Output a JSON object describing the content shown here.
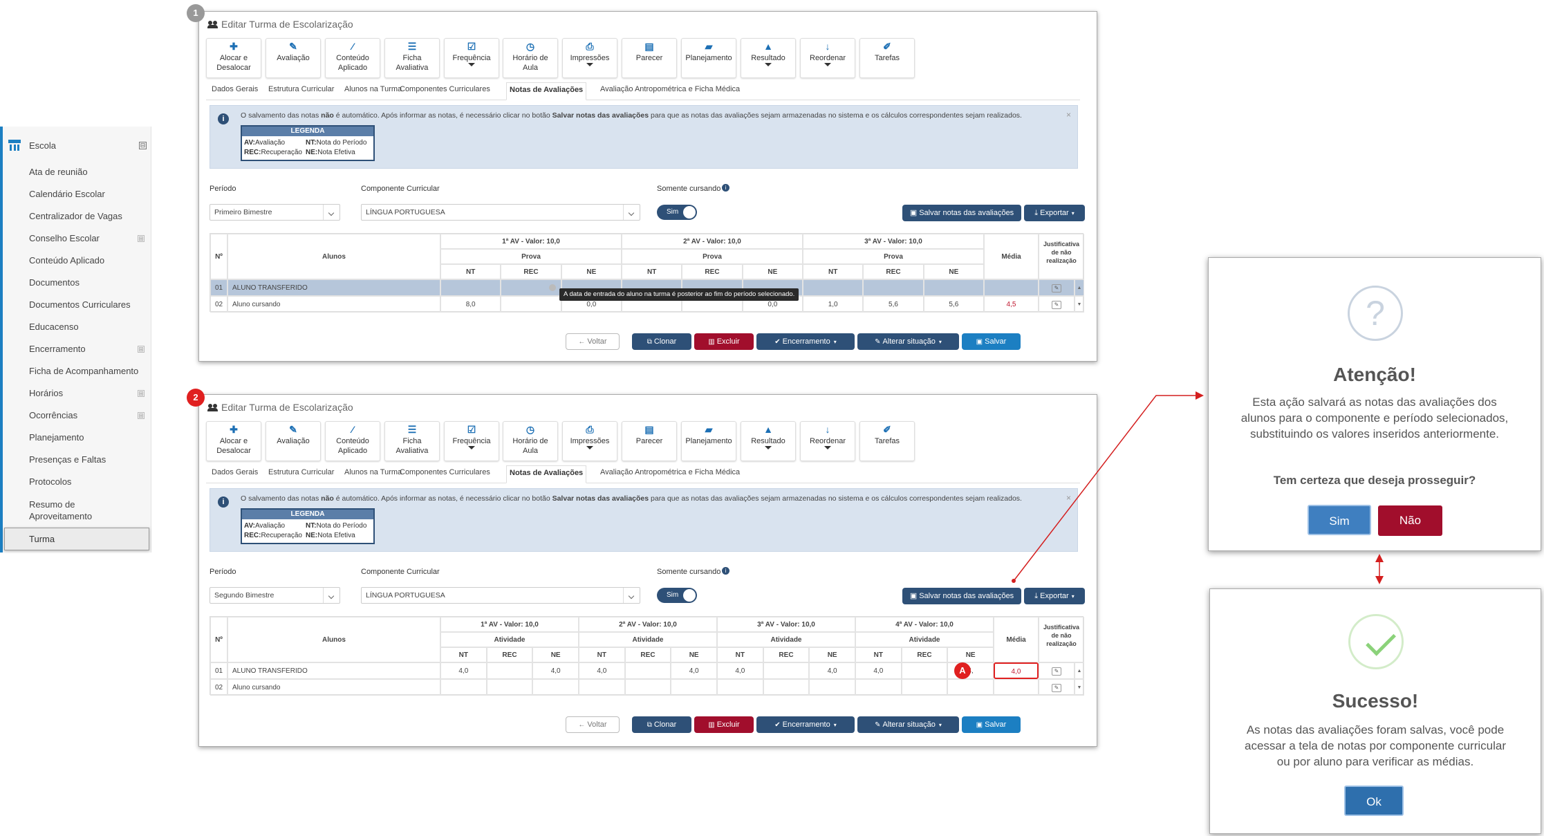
{
  "sidebar": {
    "header": "Escola",
    "items": [
      {
        "label": "Ata de reunião",
        "expand": false
      },
      {
        "label": "Calendário Escolar",
        "expand": false
      },
      {
        "label": "Centralizador de Vagas",
        "expand": false
      },
      {
        "label": "Conselho Escolar",
        "expand": true
      },
      {
        "label": "Conteúdo Aplicado",
        "expand": false
      },
      {
        "label": "Documentos",
        "expand": false
      },
      {
        "label": "Documentos Curriculares",
        "expand": false
      },
      {
        "label": "Educacenso",
        "expand": false
      },
      {
        "label": "Encerramento",
        "expand": true
      },
      {
        "label": "Ficha de Acompanhamento",
        "expand": false
      },
      {
        "label": "Horários",
        "expand": true
      },
      {
        "label": "Ocorrências",
        "expand": true
      },
      {
        "label": "Planejamento",
        "expand": false
      },
      {
        "label": "Presenças e Faltas",
        "expand": false
      },
      {
        "label": "Protocolos",
        "expand": false
      },
      {
        "label": "Resumo de Aproveitamento",
        "expand": false
      }
    ],
    "selected": "Turma",
    "toggle_symbol": "⊟",
    "expand_symbol": "⊞"
  },
  "panel_title": "Editar Turma de Escolarização",
  "toolbar": [
    {
      "label": "Alocar e Desalocar",
      "icon": "puzzle-icon",
      "glyph": "✚",
      "caret": false
    },
    {
      "label": "Avaliação",
      "icon": "edit-icon",
      "glyph": "✎",
      "caret": false
    },
    {
      "label": "Conteúdo Aplicado",
      "icon": "magic-wand-icon",
      "glyph": "⁄",
      "caret": false
    },
    {
      "label": "Ficha Avaliativa",
      "icon": "list-icon",
      "glyph": "☰",
      "caret": false
    },
    {
      "label": "Frequência",
      "icon": "check-square-icon",
      "glyph": "☑",
      "caret": true
    },
    {
      "label": "Horário de Aula",
      "icon": "clock-icon",
      "glyph": "◷",
      "caret": false
    },
    {
      "label": "Impressões",
      "icon": "printer-icon",
      "glyph": "⎙",
      "caret": true
    },
    {
      "label": "Parecer",
      "icon": "document-icon",
      "glyph": "▤",
      "caret": false
    },
    {
      "label": "Planejamento",
      "icon": "book-icon",
      "glyph": "▰",
      "caret": false
    },
    {
      "label": "Resultado",
      "icon": "graduation-cap-icon",
      "glyph": "▲",
      "caret": true
    },
    {
      "label": "Reordenar",
      "icon": "sort-alpha-icon",
      "glyph": "↓",
      "caret": true
    },
    {
      "label": "Tarefas",
      "icon": "pencil-icon",
      "glyph": "✐",
      "caret": false
    }
  ],
  "tabs": [
    "Dados Gerais",
    "Estrutura Curricular",
    "Alunos na Turma",
    "Componentes Curriculares",
    "Notas de Avaliações",
    "Avaliação Antropométrica e Ficha Médica"
  ],
  "active_tab": "Notas de Avaliações",
  "alert": {
    "part1": "O salvamento das notas ",
    "bold1": "não",
    "part2": " é automático. Após informar as notas, é necessário clicar no botão ",
    "bold2": "Salvar notas das avaliações",
    "part3": " para que as notas das avaliações sejam armazenadas no sistema e os cálculos correspondentes sejam realizados.",
    "close": "×"
  },
  "legend": {
    "title": "LEGENDA",
    "av_k": "AV:",
    "av_v": "Avaliação",
    "nt_k": "NT:",
    "nt_v": "Nota do Período",
    "rec_k": "REC:",
    "rec_v": "Recuperação",
    "ne_k": "NE:",
    "ne_v": "Nota Efetiva"
  },
  "labels": {
    "periodo": "Período",
    "componente": "Componente Curricular",
    "somente": "Somente cursando",
    "sim": "Sim"
  },
  "buttons": {
    "salvar_notas": "Salvar notas das avaliações",
    "exportar": "Exportar",
    "voltar": "Voltar",
    "clonar": "Clonar",
    "excluir": "Excluir",
    "encerramento": "Encerramento",
    "alterar": "Alterar situação",
    "salvar": "Salvar"
  },
  "table_labels": {
    "n": "Nº",
    "alunos": "Alunos",
    "media": "Média",
    "justificativa": "Justificativa de não realização",
    "nt": "NT",
    "rec": "REC",
    "ne": "NE"
  },
  "panel1": {
    "step": "1",
    "periodo": "Primeiro Bimestre",
    "componente": "LÍNGUA PORTUGUESA",
    "avs": [
      "1ª AV - Valor: 10,0",
      "2ª AV - Valor: 10,0",
      "3ª AV - Valor: 10,0"
    ],
    "sub": "Prova",
    "rows": [
      {
        "n": "01",
        "name": "ALUNO TRANSFERIDO",
        "vals": [
          "",
          "",
          "",
          "",
          "",
          "",
          "",
          "",
          ""
        ],
        "media": ""
      },
      {
        "n": "02",
        "name": "Aluno cursando",
        "vals": [
          "8,0",
          "",
          "0,0",
          "",
          "",
          "0,0",
          "1,0",
          "5,6",
          "5,6"
        ],
        "media": "4,5"
      }
    ],
    "tooltip": "A data de entrada do aluno na turma é posterior ao fim do período selecionado."
  },
  "panel2": {
    "step": "2",
    "periodo": "Segundo Bimestre",
    "componente": "LÍNGUA PORTUGUESA",
    "avs": [
      "1ª AV - Valor: 10,0",
      "2ª AV - Valor: 10,0",
      "3ª AV - Valor: 10,0",
      "4ª AV - Valor: 10,0"
    ],
    "sub": "Atividade",
    "rows": [
      {
        "n": "01",
        "name": "ALUNO TRANSFERIDO",
        "vals": [
          "4,0",
          "",
          "4,0",
          "4,0",
          "",
          "4,0",
          "4,0",
          "",
          "4,0",
          "4,0",
          "",
          "4,"
        ],
        "media": "4,0"
      },
      {
        "n": "02",
        "name": "Aluno cursando",
        "vals": [
          "",
          "",
          "",
          "",
          "",
          "",
          "",
          "",
          "",
          "",
          "",
          ""
        ],
        "media": ""
      }
    ],
    "marker": "A"
  },
  "confirm": {
    "icon": "?",
    "title": "Atenção!",
    "message": "Esta ação salvará as notas das avaliações dos alunos para o componente e período selecionados, substituindo os valores inseridos anteriormente.",
    "question": "Tem certeza que deseja prosseguir?",
    "yes": "Sim",
    "no": "Não"
  },
  "success": {
    "icon": "✓",
    "title": "Sucesso!",
    "message": "As notas das avaliações foram salvas, você pode acessar a tela de notas por componente curricular ou por aluno para verificar as médias.",
    "ok": "Ok"
  },
  "colors": {
    "primary": "#2e5077",
    "danger": "#a10e2c",
    "accent": "#1c7fc2",
    "highlight": "#e02020"
  }
}
